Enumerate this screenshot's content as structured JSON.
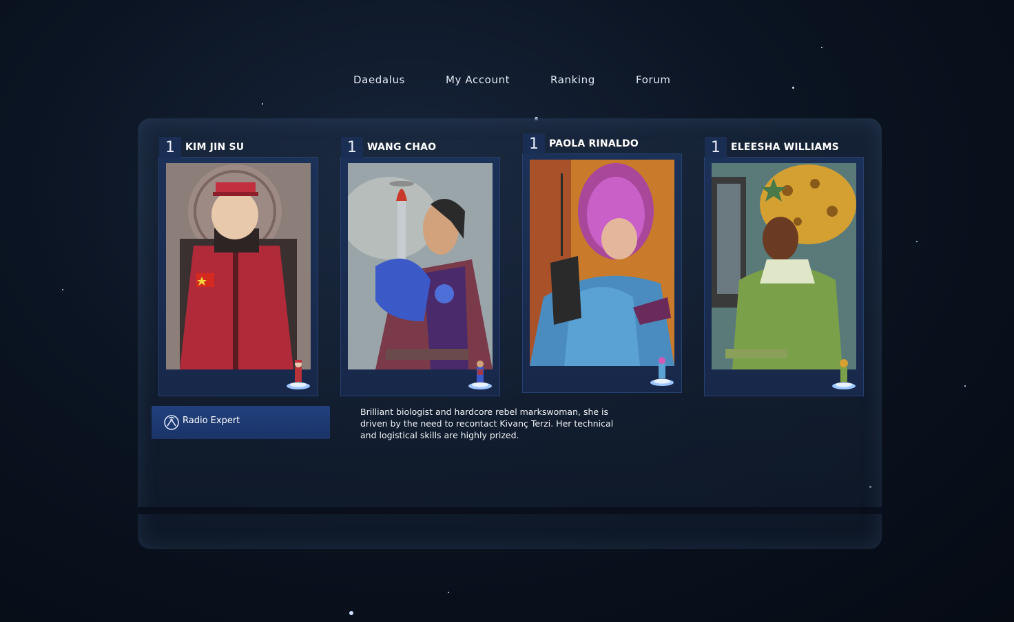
{
  "nav": {
    "items": [
      {
        "label": "Daedalus"
      },
      {
        "label": "My Account"
      },
      {
        "label": "Ranking"
      },
      {
        "label": "Forum"
      }
    ]
  },
  "characters": [
    {
      "level": "1",
      "name": "KIM JIN SU"
    },
    {
      "level": "1",
      "name": "WANG CHAO"
    },
    {
      "level": "1",
      "name": "PAOLA RINALDO"
    },
    {
      "level": "1",
      "name": "ELEESHA WILLIAMS"
    }
  ],
  "skill": {
    "icon": "radio-icon",
    "label": "Radio Expert"
  },
  "description": {
    "text": "Brilliant biologist and hardcore rebel markswoman, she is driven by the need to recontact Kivanç Terzi. Her technical and logistical skills are highly prized."
  },
  "colors": {
    "card": "#1c3158",
    "skill_box": "#21407c",
    "background": "#0b1422"
  }
}
